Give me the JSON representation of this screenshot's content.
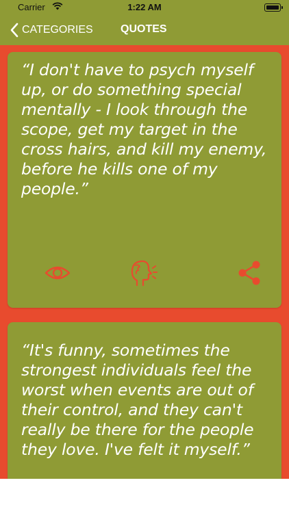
{
  "status_bar": {
    "carrier": "Carrier",
    "time": "1:22 AM"
  },
  "nav": {
    "back_label": "CATEGORIES",
    "title": "QUOTES"
  },
  "colors": {
    "background": "#e84b2e",
    "card": "#8f9b35",
    "icon": "#e84b2e",
    "text": "#ffffff"
  },
  "quotes": [
    {
      "text": "“I don't have to psych myself up, or do something special mentally - I look through the scope, get my target in the cross hairs, and kill my enemy, before he kills one of my people.”"
    },
    {
      "text": "“It's funny, sometimes the strongest individuals feel the worst when events are out of their control, and they can't really be there for the people they love. I've felt it myself.”"
    }
  ],
  "actions": [
    "eye-icon",
    "speak-icon",
    "share-icon"
  ]
}
